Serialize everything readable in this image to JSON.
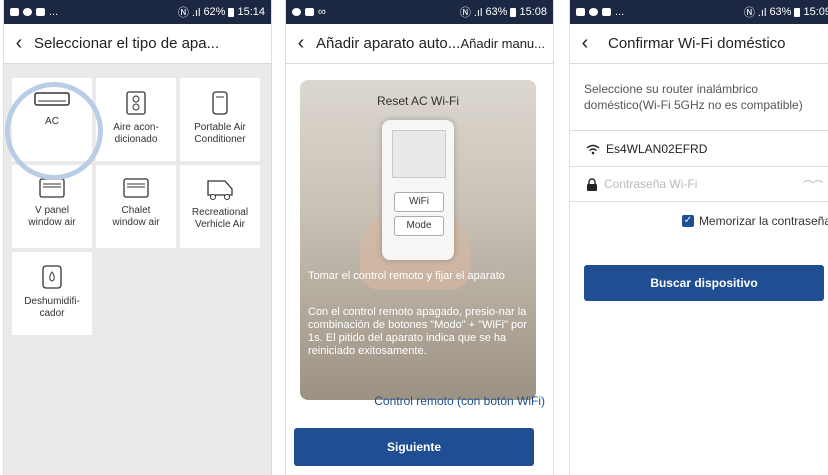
{
  "screen1": {
    "status": {
      "icons": "🖼 ☺ ▀ ...",
      "signal": "Ⓝ .ıl",
      "battery_pct": "62%",
      "time": "15:14"
    },
    "title": "Seleccionar el tipo de apa...",
    "tiles": [
      {
        "label": "AC",
        "icon": "ac-unit-icon"
      },
      {
        "label": "Aire acon-\ndicionado",
        "icon": "aircon-floor-icon"
      },
      {
        "label": "Portable Air\nConditioner",
        "icon": "portable-ac-icon"
      },
      {
        "label": "V panel\nwindow air",
        "icon": "window-ac-icon"
      },
      {
        "label": "Chalet\nwindow air",
        "icon": "chalet-ac-icon"
      },
      {
        "label": "Recreational\nVerhicle Air",
        "icon": "rv-air-icon"
      },
      {
        "label": "Deshumidifi-\ncador",
        "icon": "dehumidifier-icon"
      }
    ]
  },
  "screen2": {
    "status": {
      "icons": "☺ ▀ ∞",
      "signal": "Ⓝ .ıl",
      "battery_pct": "63%",
      "time": "15:08"
    },
    "title": "Añadir aparato auto...",
    "action": "Añadir manu...",
    "card_title": "Reset AC Wi-Fi",
    "wifi_btn": "WiFi",
    "mode_btn": "Mode",
    "instruction_1": "Tomar el control remoto y fijar el aparato",
    "instruction_2": "Con el control remoto apagado, presio-nar la combinación de botones \"Modo\" + \"WiFi\" por 1s. El pitido del aparato indica que se ha reiniciado exitosamente.",
    "link": "Control remoto (con botón WiFi)",
    "next": "Siguiente"
  },
  "screen3": {
    "status": {
      "icons": "🖼 ☺ ▀ ...",
      "signal": "Ⓝ .ıl",
      "battery_pct": "63%",
      "time": "15:09"
    },
    "title": "Confirmar Wi-Fi doméstico",
    "instruction": "Seleccione su router inalámbrico doméstico(Wi-Fi 5GHz no es compatible)",
    "ssid": "Es4WLAN02EFRD",
    "password_placeholder": "Contraseña Wi-Fi",
    "remember": "Memorizar la contraseña",
    "search": "Buscar dispositivo"
  },
  "colors": {
    "statusbar": "#1c2742",
    "primary": "#1f4e92",
    "grid_bg": "#eaeaea",
    "highlight": "#b9cde6"
  }
}
